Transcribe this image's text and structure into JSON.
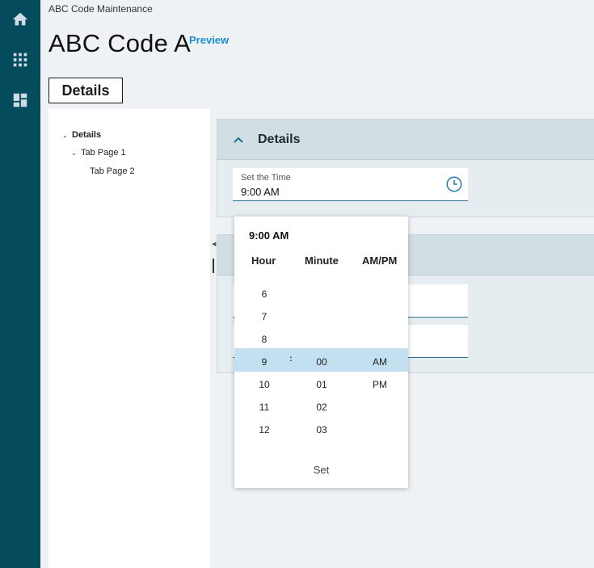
{
  "breadcrumb": "ABC Code Maintenance",
  "page_title": "ABC Code A",
  "preview_link": "Preview",
  "active_tab": "Details",
  "rail": {
    "icons": [
      "home-icon",
      "apps-grid-icon",
      "dashboard-icon"
    ]
  },
  "tree": {
    "items": [
      {
        "label": "Details",
        "expanded": true
      },
      {
        "label": "Tab Page 1",
        "expanded": true
      },
      {
        "label": "Tab Page 2"
      }
    ]
  },
  "details_section": {
    "title": "Details",
    "time_field": {
      "label": "Set the Time",
      "value": "9:00 AM"
    }
  },
  "time_picker": {
    "current": "9:00 AM",
    "headers": {
      "hour": "Hour",
      "minute": "Minute",
      "ampm": "AM/PM"
    },
    "hours": [
      "6",
      "7",
      "8",
      "9",
      "10",
      "11",
      "12"
    ],
    "minutes": [
      "00",
      "01",
      "02",
      "03"
    ],
    "ampm": [
      "AM",
      "PM"
    ],
    "selected": {
      "hour": "9",
      "minute": "00",
      "ampm": "AM"
    },
    "separator": ":",
    "set_label": "Set"
  },
  "colors": {
    "rail": "#044b5e",
    "accent": "#1a8fd4",
    "selected_band": "#c3e0f1",
    "panel_header": "#d1dfe4"
  }
}
